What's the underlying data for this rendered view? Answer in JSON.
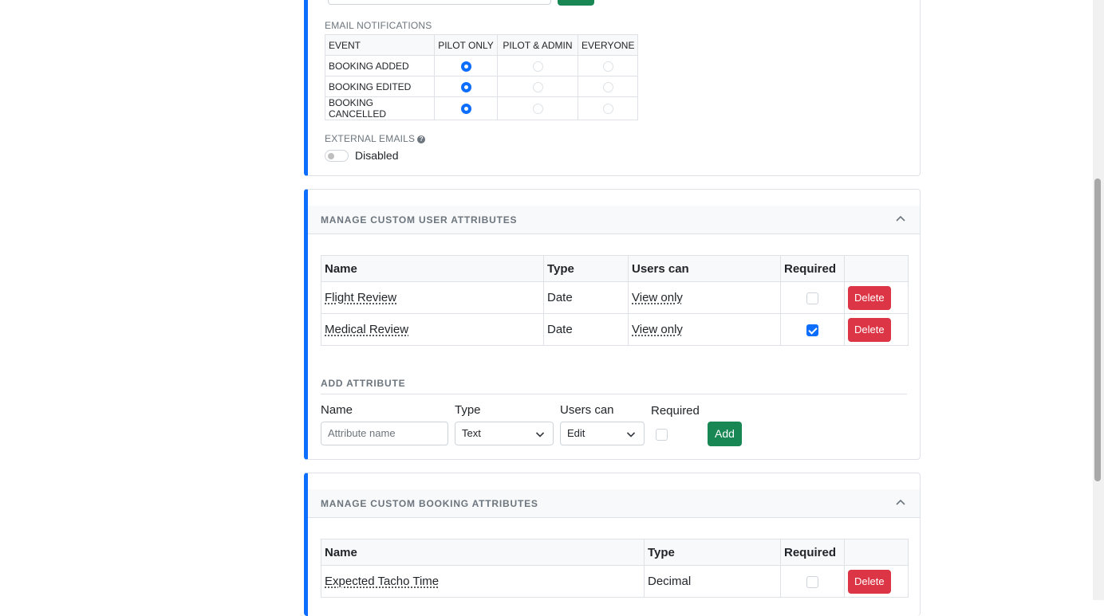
{
  "notifications": {
    "label": "EMAIL NOTIFICATIONS",
    "columns": [
      "EVENT",
      "PILOT ONLY",
      "PILOT & ADMIN",
      "EVERYONE"
    ],
    "rows": [
      {
        "event": "BOOKING ADDED",
        "selected": 0
      },
      {
        "event": "BOOKING EDITED",
        "selected": 0
      },
      {
        "event": "BOOKING CANCELLED",
        "selected": 0
      }
    ]
  },
  "external_emails": {
    "label": "EXTERNAL EMAILS",
    "help_icon": "question-circle-icon",
    "status": "Disabled"
  },
  "user_attributes": {
    "title": "MANAGE CUSTOM USER ATTRIBUTES",
    "columns": [
      "Name",
      "Type",
      "Users can",
      "Required",
      ""
    ],
    "rows": [
      {
        "name": "Flight Review",
        "type": "Date",
        "users_can": "View only",
        "required": false,
        "action": "Delete"
      },
      {
        "name": "Medical Review",
        "type": "Date",
        "users_can": "View only",
        "required": true,
        "action": "Delete"
      }
    ],
    "add": {
      "heading": "ADD ATTRIBUTE",
      "name_label": "Name",
      "name_placeholder": "Attribute name",
      "type_label": "Type",
      "type_value": "Text",
      "users_can_label": "Users can",
      "users_can_value": "Edit",
      "required_label": "Required",
      "button": "Add"
    }
  },
  "booking_attributes": {
    "title": "MANAGE CUSTOM BOOKING ATTRIBUTES",
    "columns": [
      "Name",
      "Type",
      "Required",
      ""
    ],
    "rows": [
      {
        "name": "Expected Tacho Time",
        "type": "Decimal",
        "required": false,
        "action": "Delete"
      }
    ]
  },
  "colors": {
    "accent": "#0d6efd",
    "danger": "#dc3545",
    "success": "#198754"
  }
}
